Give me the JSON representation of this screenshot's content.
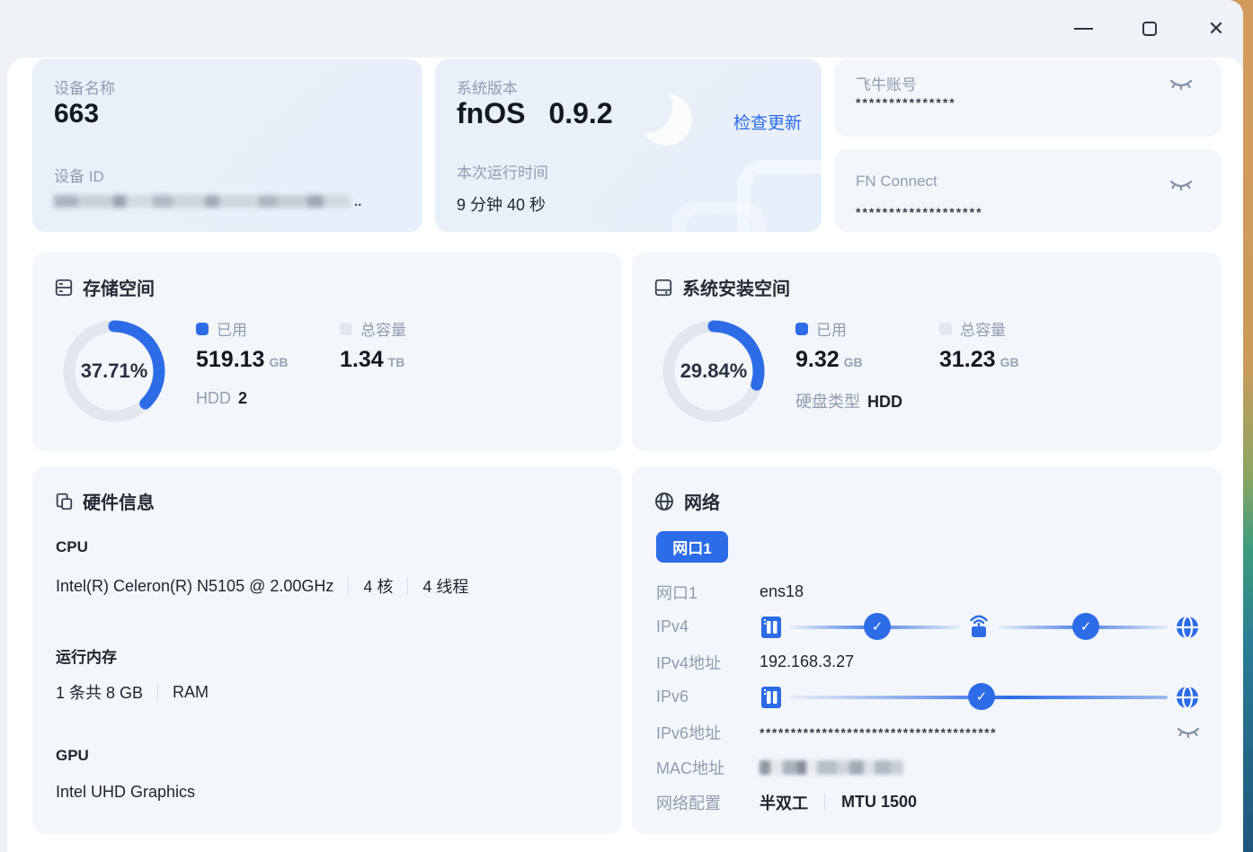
{
  "colors": {
    "accent": "#2c6ce6",
    "label_gray": "#929cb0",
    "text_dark": "#1d222c",
    "donut_track": "#e2e6ed"
  },
  "device_card": {
    "name_label": "设备名称",
    "name_value": "663",
    "id_label": "设备 ID",
    "id_suffix": ".."
  },
  "version_card": {
    "label": "系统版本",
    "os_name": "fnOS",
    "os_version": "0.9.2",
    "update_link": "检查更新",
    "uptime_label": "本次运行时间",
    "uptime_value": "9 分钟 40 秒"
  },
  "account_card": {
    "label": "飞牛账号",
    "masked_value": "***************"
  },
  "fn_connect_card": {
    "label": "FN Connect",
    "masked_value": "*******************"
  },
  "storage_card": {
    "title": "存储空间",
    "percent_text": "37.71%",
    "percent_value": 37.71,
    "used_label": "已用",
    "used_value": "519.13",
    "used_unit": "GB",
    "total_label": "总容量",
    "total_value": "1.34",
    "total_unit": "TB",
    "disk_label": "HDD",
    "disk_count": "2"
  },
  "system_card": {
    "title": "系统安装空间",
    "percent_text": "29.84%",
    "percent_value": 29.84,
    "used_label": "已用",
    "used_value": "9.32",
    "used_unit": "GB",
    "total_label": "总容量",
    "total_value": "31.23",
    "total_unit": "GB",
    "disk_type_label": "硬盘类型",
    "disk_type_value": "HDD"
  },
  "hardware_card": {
    "title": "硬件信息",
    "cpu_label": "CPU",
    "cpu_value": "Intel(R) Celeron(R) N5105 @ 2.00GHz",
    "cpu_cores": "4 核",
    "cpu_threads": "4 线程",
    "ram_label": "运行内存",
    "ram_value": "1 条共 8 GB",
    "ram_type": "RAM",
    "gpu_label": "GPU",
    "gpu_value": "Intel UHD Graphics"
  },
  "network_card": {
    "title": "网络",
    "port_button": "网口1",
    "port_label": "网口1",
    "port_value": "ens18",
    "ipv4_label": "IPv4",
    "ipv4_addr_label": "IPv4地址",
    "ipv4_addr_value": "192.168.3.27",
    "ipv6_label": "IPv6",
    "ipv6_addr_label": "IPv6地址",
    "ipv6_addr_masked": "**************************************",
    "mac_label": "MAC地址",
    "config_label": "网络配置",
    "duplex": "半双工",
    "mtu": "MTU 1500"
  }
}
